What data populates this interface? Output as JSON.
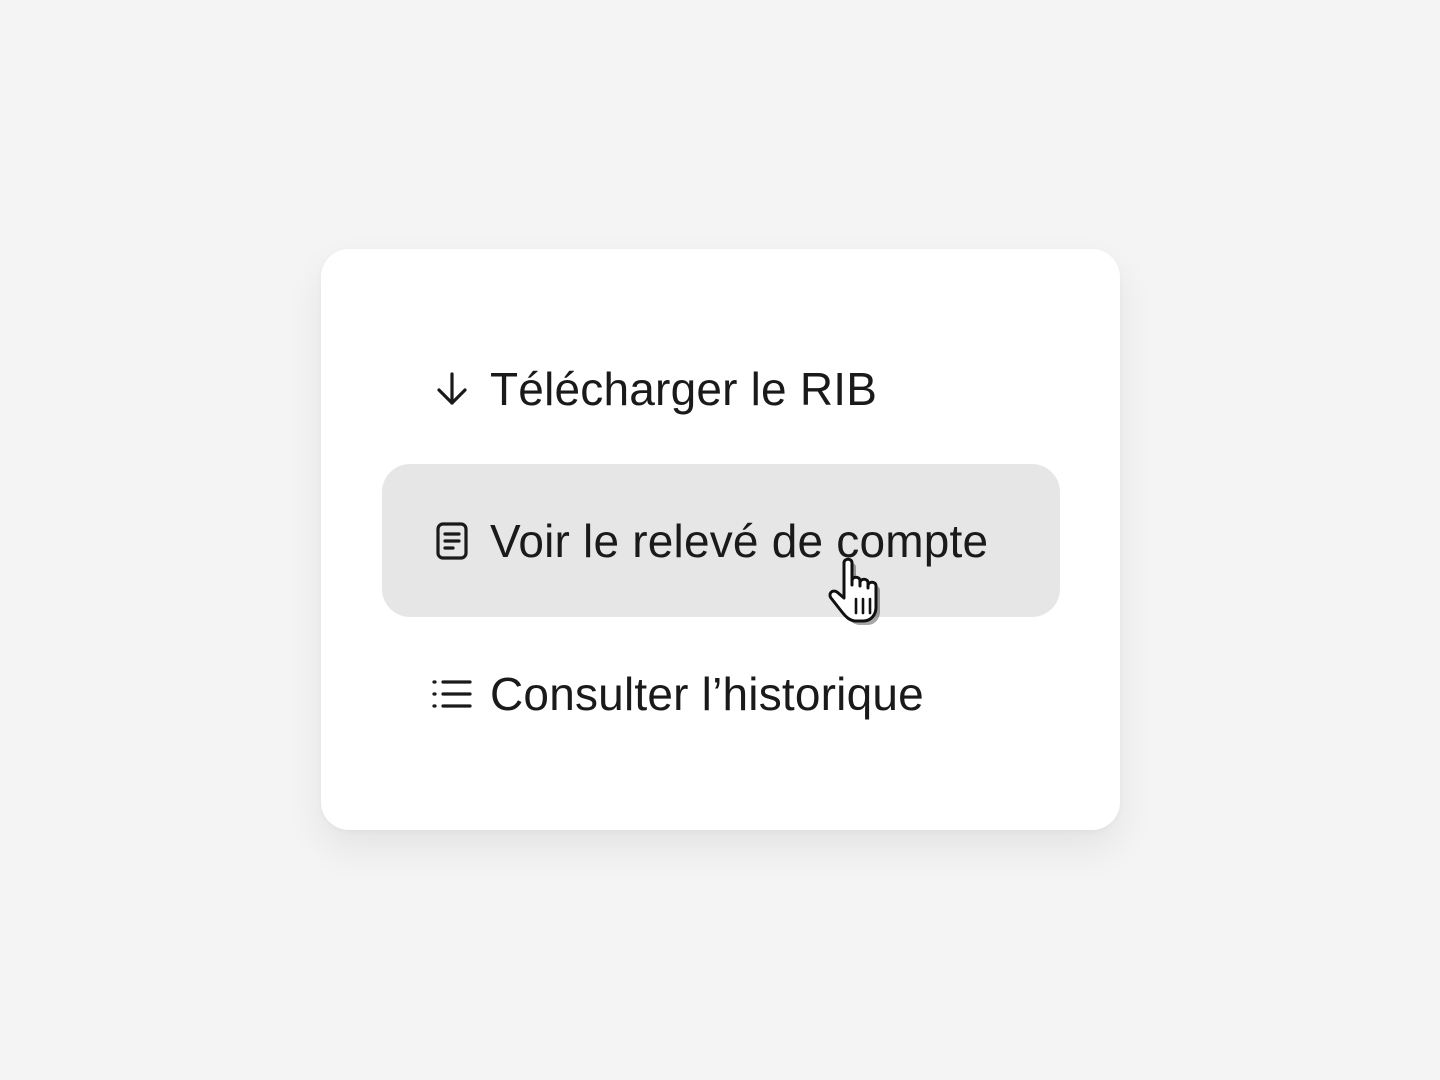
{
  "menu": {
    "items": [
      {
        "label": "Télécharger le RIB",
        "icon": "arrow-down-icon",
        "state": "default"
      },
      {
        "label": "Voir le relevé de compte",
        "icon": "document-icon",
        "state": "hover"
      },
      {
        "label": "Consulter l’historique",
        "icon": "list-icon",
        "state": "default"
      }
    ]
  },
  "cursor": {
    "icon": "hand-pointer-cursor-icon"
  },
  "colors": {
    "background": "#f4f4f4",
    "card": "#ffffff",
    "hover": "#e6e6e6",
    "text": "#1a1a1a"
  }
}
